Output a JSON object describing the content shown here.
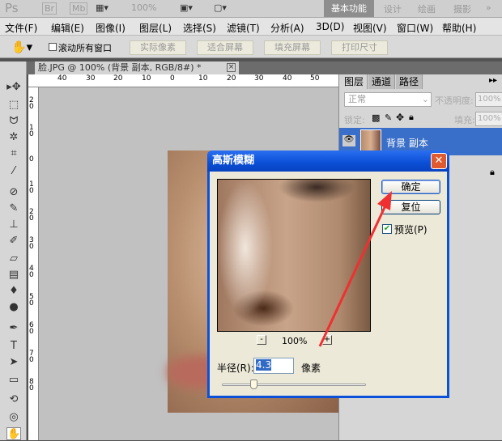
{
  "appbar": {
    "logo": "Ps",
    "br": "Br",
    "mb": "Mb",
    "zoom": "100%",
    "workspaces": [
      "基本功能",
      "设计",
      "绘画",
      "摄影"
    ],
    "more": "»"
  },
  "menu": [
    "文件(F)",
    "编辑(E)",
    "图像(I)",
    "图层(L)",
    "选择(S)",
    "滤镜(T)",
    "分析(A)",
    "3D(D)",
    "视图(V)",
    "窗口(W)",
    "帮助(H)"
  ],
  "options": {
    "scroll_all": "滚动所有窗口",
    "buttons": [
      "实际像素",
      "适合屏幕",
      "填充屏幕",
      "打印尺寸"
    ]
  },
  "document": {
    "tab": "脸.JPG @ 100% (背景 副本, RGB/8#) *",
    "close": "×"
  },
  "rulers": {
    "h": [
      "40",
      "30",
      "20",
      "10",
      "0",
      "10",
      "20",
      "30",
      "40",
      "50"
    ],
    "v": [
      "2 0",
      "1 0",
      "0",
      "1 0",
      "2 0",
      "3 0",
      "4 0",
      "5 0",
      "6 0",
      "7 0",
      "8 0"
    ]
  },
  "panel": {
    "tabs": [
      "图层",
      "通道",
      "路径"
    ],
    "blend_mode": "正常",
    "opacity_label": "不透明度:",
    "opacity": "100%",
    "lock_label": "锁定:",
    "fill_label": "填充:",
    "fill": "100%",
    "layers": [
      {
        "name": "背景 副本",
        "selected": true
      }
    ]
  },
  "dialog": {
    "title": "高斯模糊",
    "ok": "确定",
    "reset": "复位",
    "preview_label": "预览(P)",
    "preview_checked": true,
    "zoom": "100%",
    "zoom_out": "-",
    "zoom_in": "+",
    "radius_label": "半径(R):",
    "radius": "4.3",
    "unit": "像素",
    "slider_fraction": 0.22
  },
  "colors": {
    "selection": "#3a6fc9",
    "title": "#0a50d8",
    "arrow": "#f03030"
  }
}
